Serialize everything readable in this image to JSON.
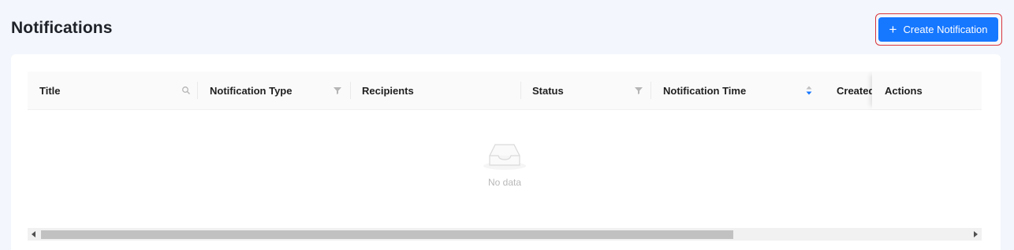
{
  "header": {
    "title": "Notifications",
    "create_button": {
      "label": "Create Notification",
      "icon": "plus-icon"
    }
  },
  "table": {
    "columns": [
      {
        "label": "Title",
        "icon": "search-icon"
      },
      {
        "label": "Notification Type",
        "icon": "filter-icon"
      },
      {
        "label": "Recipients",
        "icon": ""
      },
      {
        "label": "Status",
        "icon": "filter-icon"
      },
      {
        "label": "Notification Time",
        "icon": "sort-icon"
      },
      {
        "label": "Created",
        "icon": ""
      },
      {
        "label": "Actions",
        "icon": ""
      }
    ],
    "rows": [],
    "empty_text": "No data"
  },
  "colors": {
    "primary": "#1677ff",
    "highlight_border": "#d9363e",
    "page_bg": "#f3f6fc",
    "sort_active": "#1677ff"
  }
}
